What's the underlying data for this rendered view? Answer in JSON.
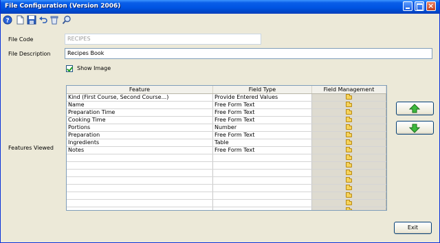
{
  "window": {
    "title": "File Configuration (Version 2006)"
  },
  "toolbar": {
    "icons": [
      "help-icon",
      "new-document-icon",
      "save-icon",
      "undo-icon",
      "delete-icon",
      "search-icon"
    ]
  },
  "form": {
    "file_code_label": "File Code",
    "file_code_value": "RECIPES",
    "file_description_label": "File Description",
    "file_description_value": "Recipes Book",
    "show_image_label": "Show Image",
    "show_image_checked": true,
    "features_viewed_label": "Features Viewed"
  },
  "grid": {
    "columns": [
      "Feature",
      "Field Type",
      "Field Management"
    ],
    "rows": [
      {
        "feature": "Kind (First Course, Second Course...)",
        "type": "Provide Entered Values"
      },
      {
        "feature": "Name",
        "type": "Free Form Text"
      },
      {
        "feature": "Preparation Time",
        "type": "Free Form Text"
      },
      {
        "feature": "Cooking Time",
        "type": "Free Form Text"
      },
      {
        "feature": "Portions",
        "type": "Number"
      },
      {
        "feature": "Preparation",
        "type": "Free Form Text"
      },
      {
        "feature": "Ingredients",
        "type": "Table"
      },
      {
        "feature": "Notes",
        "type": "Free Form Text"
      },
      {
        "feature": "",
        "type": ""
      },
      {
        "feature": "",
        "type": ""
      },
      {
        "feature": "",
        "type": ""
      },
      {
        "feature": "",
        "type": ""
      },
      {
        "feature": "",
        "type": ""
      },
      {
        "feature": "",
        "type": ""
      },
      {
        "feature": "",
        "type": ""
      },
      {
        "feature": "",
        "type": ""
      }
    ]
  },
  "buttons": {
    "exit_label": "Exit",
    "move_up": "arrow-up-icon",
    "move_down": "arrow-down-icon"
  },
  "colors": {
    "titlebar": "#0054e3",
    "window_bg": "#ece9d8",
    "arrow_green": "#2fa82f"
  }
}
